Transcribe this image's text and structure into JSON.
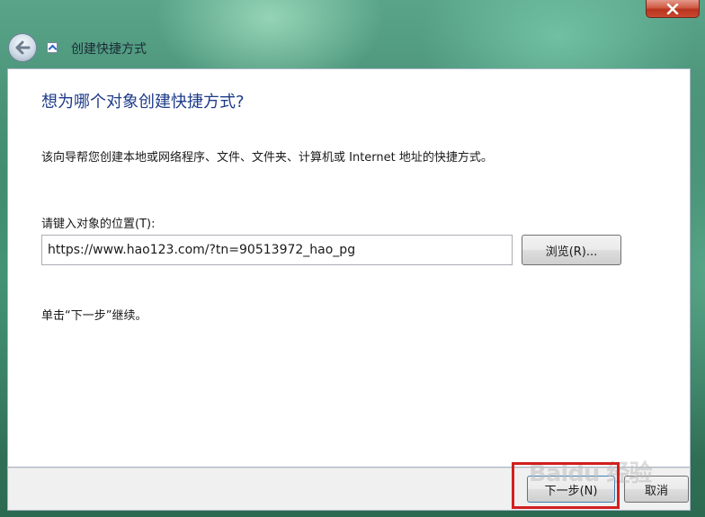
{
  "window": {
    "title": "创建快捷方式",
    "close_glyph": "x"
  },
  "wizard": {
    "heading": "想为哪个对象创建快捷方式?",
    "description": "该向导帮您创建本地或网络程序、文件、文件夹、计算机或 Internet 地址的快捷方式。",
    "location_label": "请键入对象的位置(T):",
    "location_value": "https://www.hao123.com/?tn=90513972_hao_pg",
    "browse_label": "浏览(R)...",
    "hint": "单击“下一步”继续。"
  },
  "footer": {
    "next_label": "下一步(N)",
    "cancel_label": "取消"
  },
  "watermark": "Baidu 经验",
  "colors": {
    "heading": "#1e3b8a",
    "highlight": "#d12020",
    "close_button": "#c9482f"
  }
}
